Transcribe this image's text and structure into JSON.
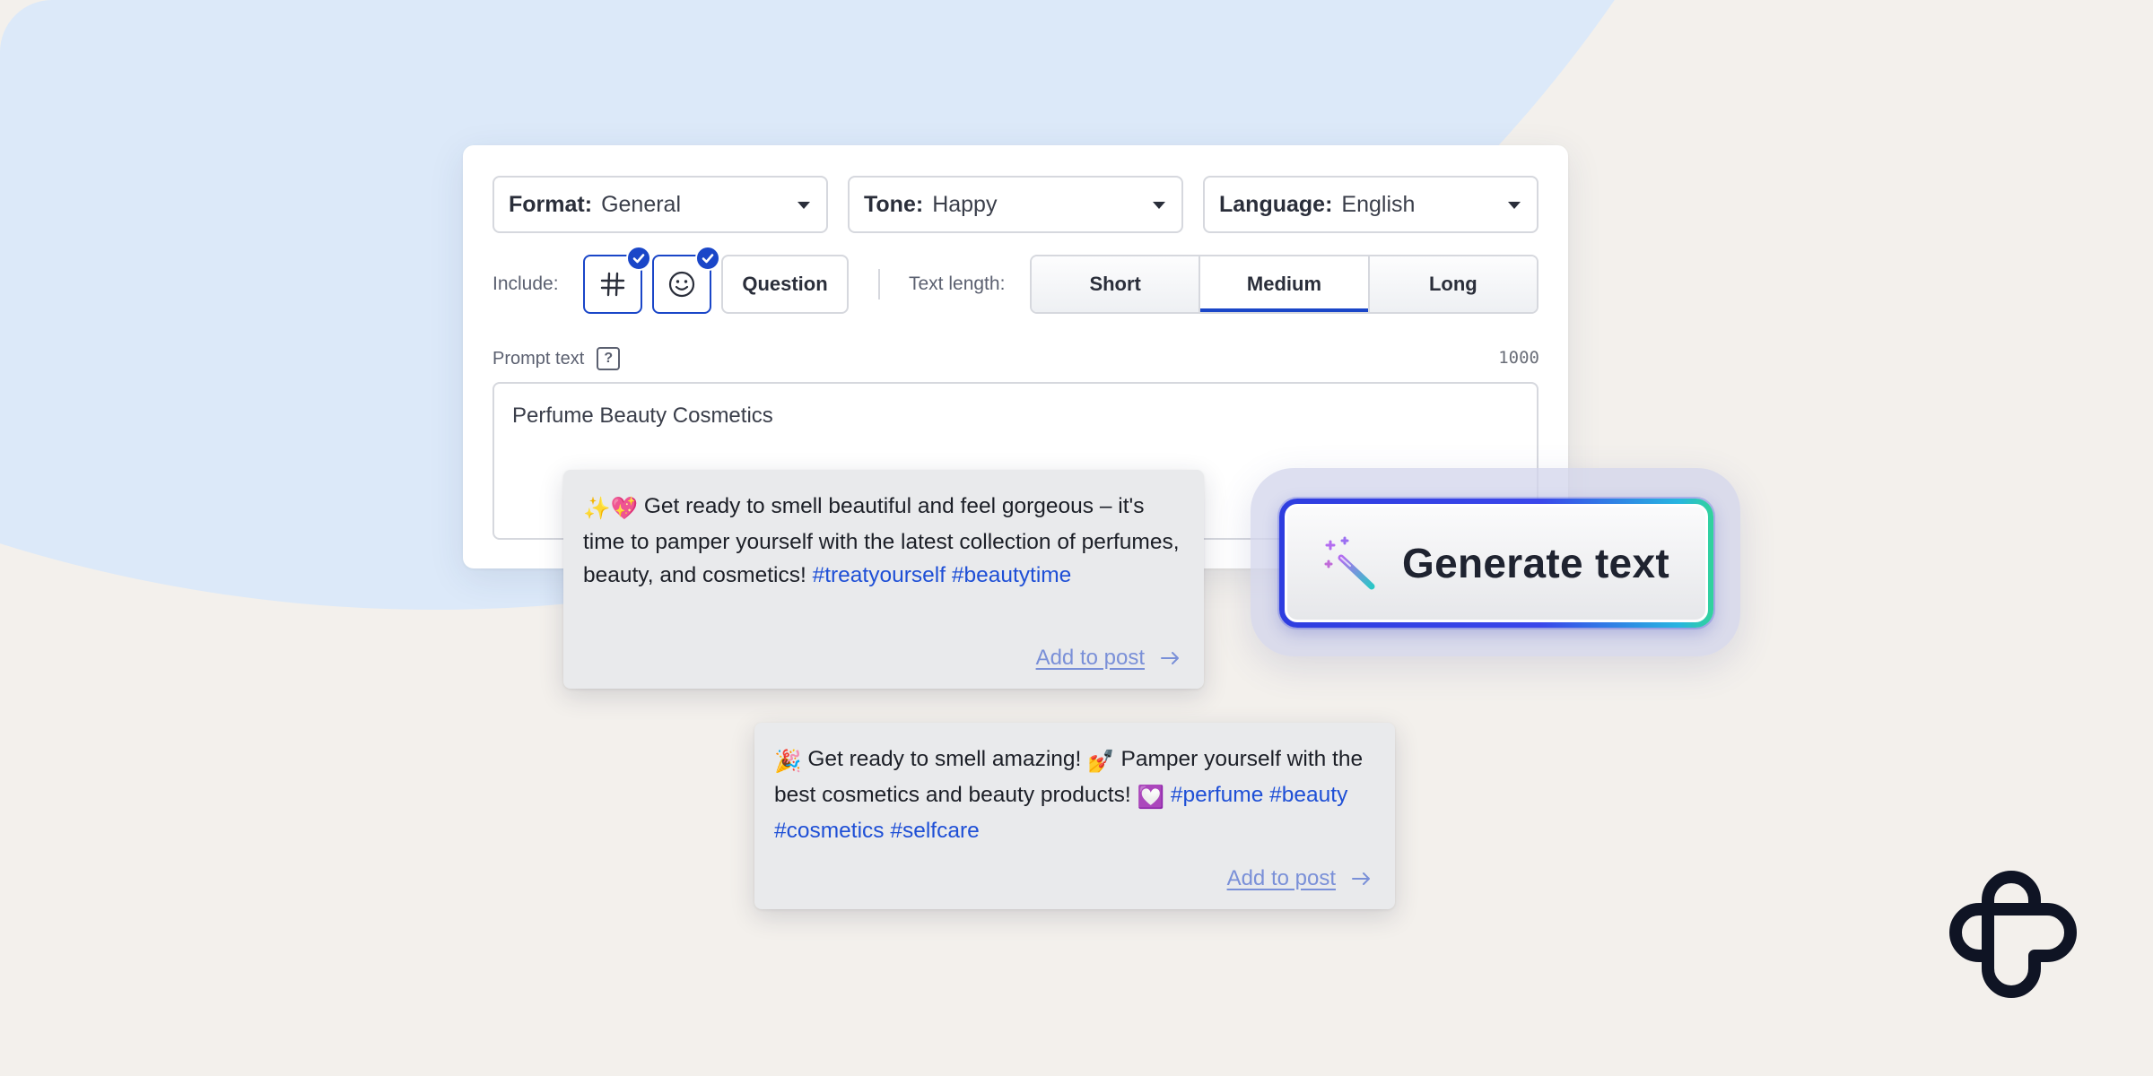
{
  "controls": {
    "format": {
      "label": "Format:",
      "value": "General"
    },
    "tone": {
      "label": "Tone:",
      "value": "Happy"
    },
    "language": {
      "label": "Language:",
      "value": "English"
    },
    "include_label": "Include:",
    "include_options": [
      {
        "name": "hashtag",
        "icon": "hash-icon",
        "checked": true
      },
      {
        "name": "emoji",
        "icon": "smiley-icon",
        "checked": true
      }
    ],
    "question_label": "Question",
    "text_length_label": "Text length:",
    "text_length_options": [
      "Short",
      "Medium",
      "Long"
    ],
    "text_length_selected": "Medium",
    "prompt_label": "Prompt text",
    "prompt_help": "?",
    "char_count": "1000",
    "prompt_value": "Perfume Beauty Cosmetics"
  },
  "results": [
    {
      "emoji": "✨💖",
      "text": "Get ready to smell beautiful and feel gorgeous – it's time to pamper yourself with the latest collection of perfumes, beauty, and cosmetics!",
      "hashtags": [
        "#treatyourself",
        "#beautytime"
      ],
      "action": "Add to post"
    },
    {
      "emoji": "🎉",
      "text_a": "Get ready to smell amazing!",
      "emoji_b": "💅",
      "text_b": "Pamper yourself with the best cosmetics and beauty products!",
      "emoji_c": "💟",
      "hashtags": [
        "#perfume",
        "#beauty",
        "#cosmetics",
        "#selfcare"
      ],
      "action": "Add to post"
    }
  ],
  "generate_button": {
    "label": "Generate text",
    "icon": "magic-wand-icon"
  },
  "brand": {
    "logo": "app-logo",
    "accent": "#1a46c8",
    "hashtag_color": "#1e4fd6"
  }
}
